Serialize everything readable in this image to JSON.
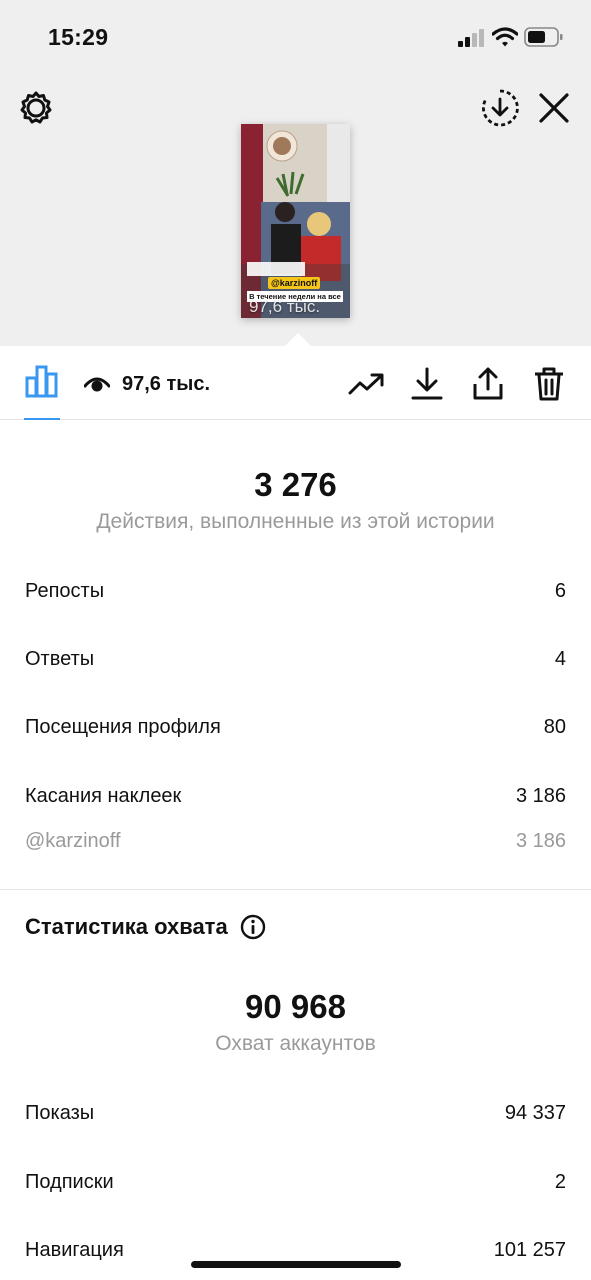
{
  "status_bar": {
    "time": "15:29"
  },
  "story_preview": {
    "sticker_handle": "@karzinoff",
    "caption": "В течение недели на все",
    "views_overlay": "97,6 тыс."
  },
  "toolbar": {
    "views_count": "97,6 тыс.",
    "icons": [
      "bar-chart-icon",
      "eye-icon",
      "trending-icon",
      "download-icon",
      "share-icon",
      "trash-icon"
    ],
    "accent": "#3897f0"
  },
  "interactions": {
    "total": "3 276",
    "subtitle": "Действия, выполненные из этой истории",
    "rows": [
      {
        "label": "Репосты",
        "value": "6"
      },
      {
        "label": "Ответы",
        "value": "4"
      },
      {
        "label": "Посещения профиля",
        "value": "80"
      },
      {
        "label": "Касания наклеек",
        "value": "3 186"
      }
    ],
    "sub_row": {
      "label": "@karzinoff",
      "value": "3 186"
    }
  },
  "reach": {
    "title": "Статистика охвата",
    "total": "90 968",
    "subtitle": "Охват аккаунтов",
    "rows": [
      {
        "label": "Показы",
        "value": "94 337"
      },
      {
        "label": "Подписки",
        "value": "2"
      },
      {
        "label": "Навигация",
        "value": "101 257"
      }
    ]
  }
}
